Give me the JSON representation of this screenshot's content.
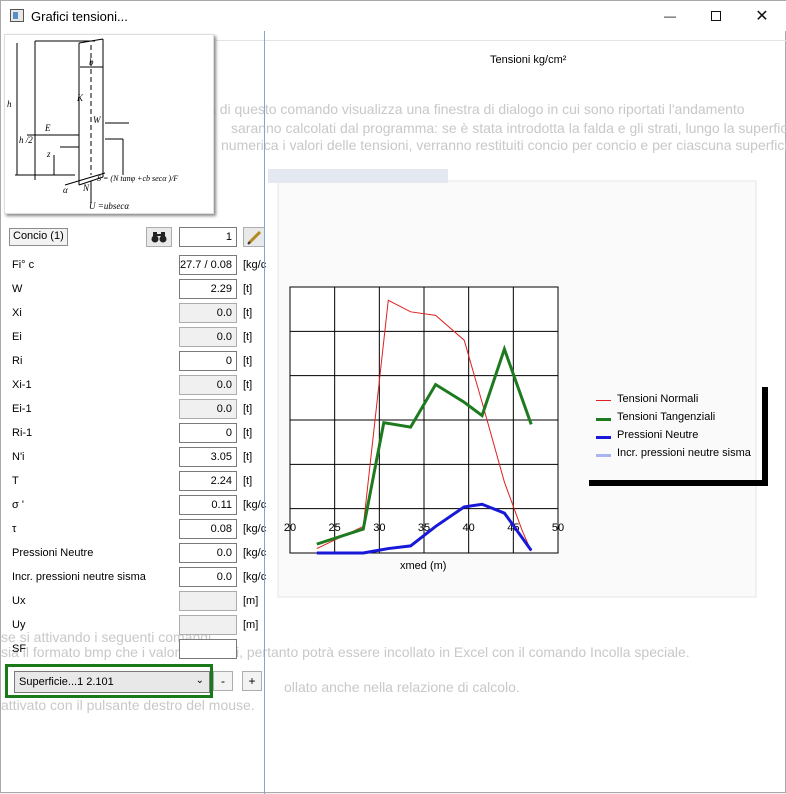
{
  "window": {
    "title": "Grafici tensioni...",
    "controls": {
      "minimize": "—",
      "close": "✕"
    }
  },
  "background_doc": {
    "lines": [
      "olo, la scelta di questo comando visualizza una finestra di dialogo in cui sono riportati l'andamento",
      "saranno calcolati dal programma: se è stata introdotta la falda e gli strati, lungo la superficie di sco",
      "numerica i valori delle tensioni, verranno restituiti concio per concio e per ciascuna superficie di s",
      "se si attivando i seguenti comandi",
      "sia il formato bmp che i valori numerici, pertanto potrà essere incollato in Excel con il comando Incolla speciale.",
      "ollato anche nella relazione di calcolo.",
      "attivato con il pulsante destro del mouse."
    ]
  },
  "left_panel": {
    "concio_button": "Concio (1)",
    "concio_number": "1",
    "fields": [
      {
        "label": "Fi° c",
        "value": "27.7 / 0.08",
        "unit": "[kg/c",
        "readonly": false
      },
      {
        "label": "W",
        "value": "2.29",
        "unit": "[t]",
        "readonly": false
      },
      {
        "label": "Xi",
        "value": "0.0",
        "unit": "[t]",
        "readonly": true
      },
      {
        "label": "Ei",
        "value": "0.0",
        "unit": "[t]",
        "readonly": true
      },
      {
        "label": "Ri",
        "value": "0",
        "unit": "[t]",
        "readonly": false
      },
      {
        "label": "Xi-1",
        "value": "0.0",
        "unit": "[t]",
        "readonly": true
      },
      {
        "label": "Ei-1",
        "value": "0.0",
        "unit": "[t]",
        "readonly": true
      },
      {
        "label": "Ri-1",
        "value": "0",
        "unit": "[t]",
        "readonly": false
      },
      {
        "label": "N'i",
        "value": "3.05",
        "unit": "[t]",
        "readonly": false
      },
      {
        "label": "T",
        "value": "2.24",
        "unit": "[t]",
        "readonly": false
      },
      {
        "label": "σ '",
        "value": "0.11",
        "unit": "[kg/c",
        "readonly": false
      },
      {
        "label": "τ",
        "value": "0.08",
        "unit": "[kg/c",
        "readonly": false
      },
      {
        "label": "Pressioni Neutre",
        "value": "0.0",
        "unit": "[kg/c",
        "readonly": false
      },
      {
        "label": "Incr. pressioni neutre sisma",
        "value": "0.0",
        "unit": "[kg/c",
        "readonly": false
      },
      {
        "label": "Ux",
        "value": "",
        "unit": "[m]",
        "readonly": true
      },
      {
        "label": "Uy",
        "value": "",
        "unit": "[m]",
        "readonly": true
      },
      {
        "label": "SF",
        "value": "",
        "unit": "",
        "readonly": false
      }
    ],
    "surface_select": "Superficie...1  2.101",
    "minus_label": "-",
    "plus_label": "+",
    "diagram_labels": {
      "b": "b",
      "K": "K",
      "W": "W",
      "hi": "h",
      "hi2": "h /2",
      "Ei": "E",
      "zi": "z",
      "alpha": "α",
      "N": "N",
      "Si": "S = (N tanφ +cb secα )/F",
      "Ui": "U =ubsecα"
    }
  },
  "chart": {
    "title": "Tensioni  kg/cm²",
    "xlabel": "xmed (m)"
  },
  "chart_data": {
    "type": "line",
    "title": "Tensioni  kg/cm²",
    "xlabel": "xmed (m)",
    "ylabel": "",
    "xlim": [
      20,
      50
    ],
    "x_ticks": [
      20,
      25,
      30,
      35,
      40,
      45,
      50
    ],
    "ylim": [
      0,
      3
    ],
    "grid": true,
    "legend_position": "right",
    "series": [
      {
        "name": "Tensioni Normali",
        "color": "#e02020",
        "width": 1,
        "x": [
          23,
          28.2,
          31,
          33.5,
          36.3,
          39.5,
          41.5,
          44,
          46,
          47
        ],
        "y": [
          0.05,
          0.3,
          2.85,
          2.72,
          2.68,
          2.4,
          1.7,
          0.8,
          0.25,
          0.02
        ]
      },
      {
        "name": "Tensioni Tangenziali",
        "color": "#1e7a1e",
        "width": 3,
        "x": [
          23,
          28.2,
          30.5,
          33.5,
          36.3,
          39.5,
          41.5,
          44,
          47
        ],
        "y": [
          0.1,
          0.27,
          1.47,
          1.42,
          1.9,
          1.7,
          1.55,
          2.3,
          1.45
        ]
      },
      {
        "name": "Pressioni Neutre",
        "color": "#1818d8",
        "width": 3,
        "x": [
          23,
          28.2,
          31,
          33.5,
          36.3,
          39.5,
          41.5,
          44,
          47
        ],
        "y": [
          0.0,
          0.0,
          0.05,
          0.08,
          0.3,
          0.52,
          0.55,
          0.45,
          0.03
        ]
      },
      {
        "name": "Incr. pressioni neutre sisma",
        "color": "#a8b4f4",
        "width": 3,
        "x": [],
        "y": []
      }
    ]
  }
}
